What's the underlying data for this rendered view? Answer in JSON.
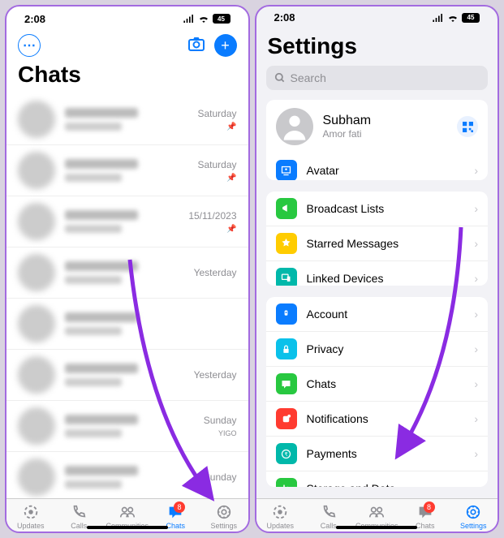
{
  "status": {
    "time": "2:08",
    "battery": "45"
  },
  "left": {
    "title": "Chats",
    "chats": [
      {
        "time": "Saturday",
        "pinned": true
      },
      {
        "time": "Saturday",
        "pinned": true
      },
      {
        "time": "15/11/2023",
        "pinned": true
      },
      {
        "time": "Yesterday",
        "pinned": false
      },
      {
        "time": "",
        "pinned": false
      },
      {
        "time": "Yesterday",
        "pinned": false
      },
      {
        "time": "Sunday",
        "pinned": false,
        "tag": "YIGO"
      },
      {
        "time": "Sunday",
        "pinned": false
      }
    ]
  },
  "right": {
    "title": "Settings",
    "search_placeholder": "Search",
    "profile": {
      "name": "Subham",
      "status": "Amor fati"
    },
    "section1": [
      {
        "label": "Avatar",
        "color": "#0a7cff",
        "name": "avatar"
      }
    ],
    "section2": [
      {
        "label": "Broadcast Lists",
        "color": "#28c840",
        "name": "broadcast-lists"
      },
      {
        "label": "Starred Messages",
        "color": "#ffcc00",
        "name": "starred-messages"
      },
      {
        "label": "Linked Devices",
        "color": "#00b8aa",
        "name": "linked-devices"
      }
    ],
    "section3": [
      {
        "label": "Account",
        "color": "#0a7cff",
        "name": "account"
      },
      {
        "label": "Privacy",
        "color": "#0ac1ea",
        "name": "privacy"
      },
      {
        "label": "Chats",
        "color": "#28c840",
        "name": "chats"
      },
      {
        "label": "Notifications",
        "color": "#ff3b30",
        "name": "notifications"
      },
      {
        "label": "Payments",
        "color": "#00b8aa",
        "name": "payments"
      },
      {
        "label": "Storage and Data",
        "color": "#28c840",
        "name": "storage-and-data"
      }
    ]
  },
  "tabs": [
    {
      "label": "Updates",
      "name": "updates"
    },
    {
      "label": "Calls",
      "name": "calls"
    },
    {
      "label": "Communities",
      "name": "communities"
    },
    {
      "label": "Chats",
      "name": "chats",
      "badge": "8"
    },
    {
      "label": "Settings",
      "name": "settings"
    }
  ]
}
